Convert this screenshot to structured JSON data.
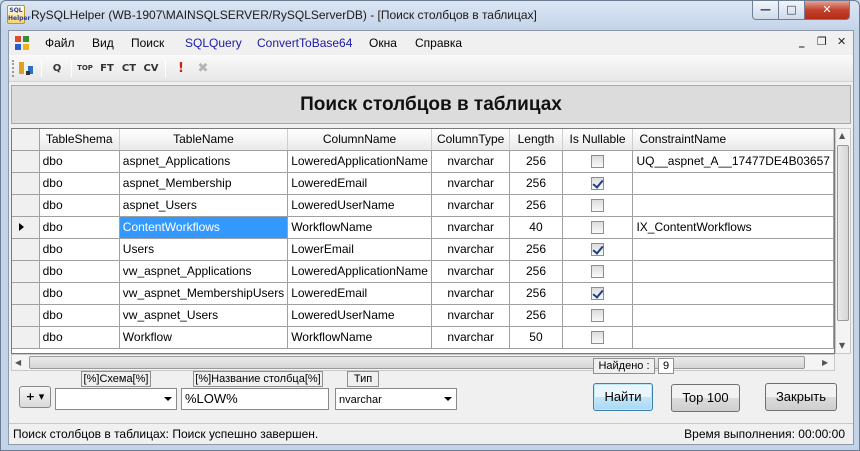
{
  "window": {
    "icon_text": "SQL Helper",
    "title": "RySQLHelper  (WB-1907\\MAINSQLSERVER/RySQLServerDB) - [Поиск столбцов в таблицах]",
    "min_glyph": "—",
    "max_glyph": "□",
    "close_glyph": "✕"
  },
  "menu": {
    "items": [
      "Файл",
      "Вид",
      "Поиск",
      "SQLQuery",
      "ConvertToBase64",
      "Окна",
      "Справка"
    ],
    "mdi_min": "_",
    "mdi_restore": "❐",
    "mdi_close": "✕"
  },
  "toolbar": {
    "q": "Q",
    "top": "TOP",
    "ft": "FT",
    "ct": "CT",
    "cv": "CV",
    "alert": "!",
    "cancel": "✖"
  },
  "header": {
    "title": "Поиск столбцов в таблицах"
  },
  "grid": {
    "columns": [
      "TableShema",
      "TableName",
      "ColumnName",
      "ColumnType",
      "Length",
      "Is Nullable",
      "ConstraintName"
    ],
    "rows": [
      {
        "schema": "dbo",
        "table": "aspnet_Applications",
        "column": "LoweredApplicationName",
        "type": "nvarchar",
        "length": "256",
        "nullable": false,
        "constraint": "UQ__aspnet_A__17477DE4B03657"
      },
      {
        "schema": "dbo",
        "table": "aspnet_Membership",
        "column": "LoweredEmail",
        "type": "nvarchar",
        "length": "256",
        "nullable": true,
        "constraint": ""
      },
      {
        "schema": "dbo",
        "table": "aspnet_Users",
        "column": "LoweredUserName",
        "type": "nvarchar",
        "length": "256",
        "nullable": false,
        "constraint": ""
      },
      {
        "schema": "dbo",
        "table": "ContentWorkflows",
        "column": "WorkflowName",
        "type": "nvarchar",
        "length": "40",
        "nullable": false,
        "constraint": "IX_ContentWorkflows"
      },
      {
        "schema": "dbo",
        "table": "Users",
        "column": "LowerEmail",
        "type": "nvarchar",
        "length": "256",
        "nullable": true,
        "constraint": ""
      },
      {
        "schema": "dbo",
        "table": "vw_aspnet_Applications",
        "column": "LoweredApplicationName",
        "type": "nvarchar",
        "length": "256",
        "nullable": false,
        "constraint": ""
      },
      {
        "schema": "dbo",
        "table": "vw_aspnet_MembershipUsers",
        "column": "LoweredEmail",
        "type": "nvarchar",
        "length": "256",
        "nullable": true,
        "constraint": ""
      },
      {
        "schema": "dbo",
        "table": "vw_aspnet_Users",
        "column": "LoweredUserName",
        "type": "nvarchar",
        "length": "256",
        "nullable": false,
        "constraint": ""
      },
      {
        "schema": "dbo",
        "table": "Workflow",
        "column": "WorkflowName",
        "type": "nvarchar",
        "length": "50",
        "nullable": false,
        "constraint": ""
      }
    ],
    "current_row": 3,
    "selected_cell": "table"
  },
  "filters": {
    "plus_label": "+ ▾",
    "schema_label": "[%]Схема[%]",
    "schema_value": "",
    "column_label": "[%]Название столбца[%]",
    "column_value": "%LOW%",
    "type_label": "Тип",
    "type_value": "nvarchar"
  },
  "found": {
    "label": "Найдено :",
    "count": "9"
  },
  "buttons": {
    "find": "Найти",
    "top100": "Top 100",
    "close": "Закрыть"
  },
  "status": {
    "message": "Поиск столбцов в таблицах: Поиск успешно завершен.",
    "elapsed": "Время выполнения: 00:00:00"
  }
}
